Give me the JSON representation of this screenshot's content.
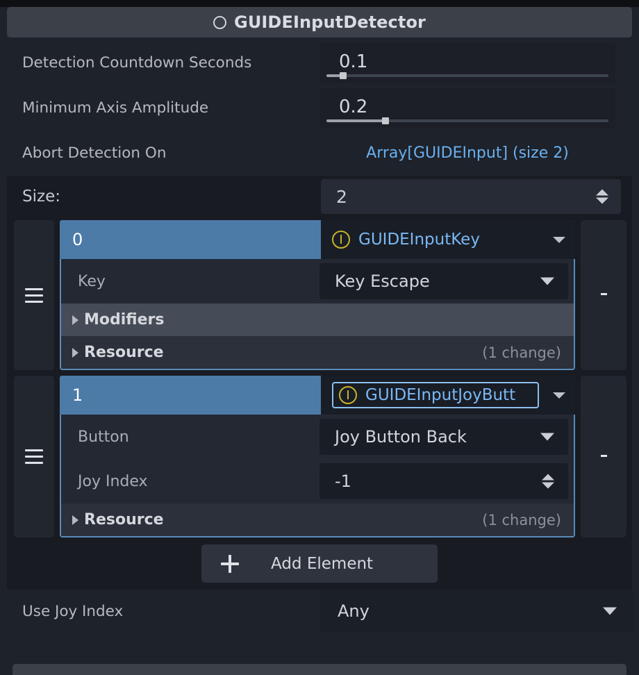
{
  "header": {
    "icon": "node-circle-icon",
    "title": "GUIDEInputDetector"
  },
  "properties": [
    {
      "label": "Detection Countdown Seconds",
      "value": "0.1",
      "slider_percent": 6
    },
    {
      "label": "Minimum Axis Amplitude",
      "value": "0.2",
      "slider_percent": 21
    }
  ],
  "array_property": {
    "label": "Abort Detection On",
    "type_summary": "Array[GUIDEInput] (size 2)",
    "accent_color": "#6ab0ef",
    "size_label": "Size:",
    "size_value": "2",
    "add_button_label": "Add Element",
    "elements": [
      {
        "index": "0",
        "type_name": "GUIDEInputKey",
        "status_icon": "warning-circle-icon",
        "focused": false,
        "sub_rows": [
          {
            "kind": "enum",
            "label": "Key",
            "value": "Key Escape"
          }
        ],
        "fold_rows": [
          {
            "label": "Modifiers",
            "note": "",
            "hover": true
          },
          {
            "label": "Resource",
            "note": "(1 change)",
            "hover": false
          }
        ],
        "drag_handle_icon": "drag-handle-icon",
        "delete_icon": "trash-icon"
      },
      {
        "index": "1",
        "type_name": "GUIDEInputJoyButt",
        "status_icon": "warning-circle-icon",
        "focused": true,
        "sub_rows": [
          {
            "kind": "enum",
            "label": "Button",
            "value": "Joy Button Back"
          },
          {
            "kind": "spin",
            "label": "Joy Index",
            "value": "-1"
          }
        ],
        "fold_rows": [
          {
            "label": "Resource",
            "note": "(1 change)",
            "hover": false
          }
        ],
        "drag_handle_icon": "drag-handle-icon",
        "delete_icon": "trash-icon"
      }
    ]
  },
  "bottom_property": {
    "label": "Use Joy Index",
    "value": "Any"
  },
  "colors": {
    "panel_bg": "#1e222a",
    "header_bg": "#3b4049",
    "element_index_bg": "#4c7ba8",
    "focus_ring": "#8cc0f0",
    "warning": "#c9b32b",
    "link": "#6ab0ef"
  }
}
